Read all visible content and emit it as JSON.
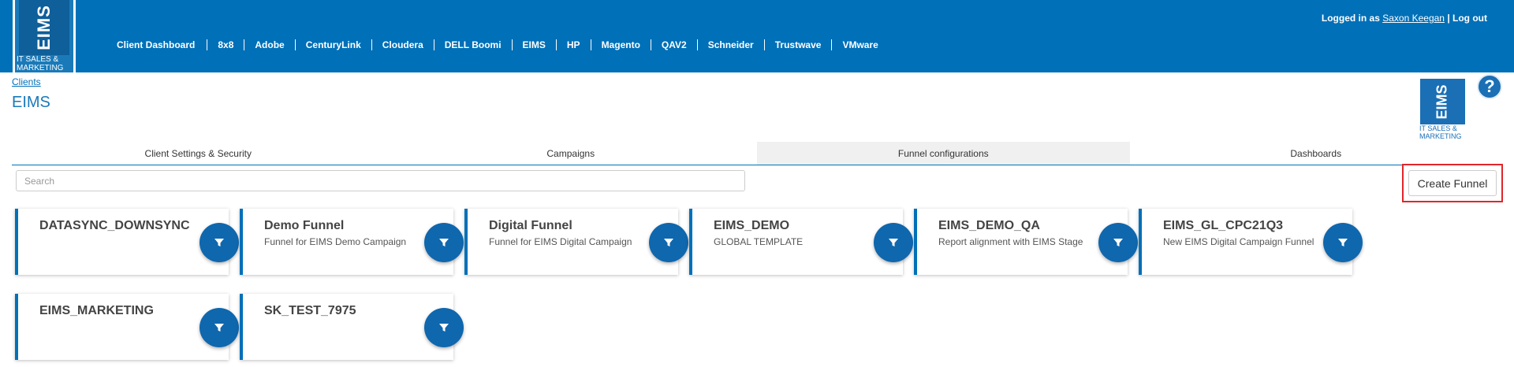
{
  "header": {
    "logo_word": "EIMS",
    "logo_tagline": "IT SALES & MARKETING",
    "nav": [
      "Client Dashboard",
      "8x8",
      "Adobe",
      "CenturyLink",
      "Cloudera",
      "DELL Boomi",
      "EIMS",
      "HP",
      "Magento",
      "QAV2",
      "Schneider",
      "Trustwave",
      "VMware"
    ],
    "login_prefix": "Logged in as",
    "user_name": "Saxon Keegan",
    "separator": "|",
    "logout": "Log out"
  },
  "breadcrumb": "Clients",
  "page_title": "EIMS",
  "help_label": "?",
  "tabs": [
    "Client Settings & Security",
    "Campaigns",
    "Funnel configurations",
    "Dashboards"
  ],
  "active_tab": "Funnel configurations",
  "search": {
    "placeholder": "Search",
    "value": ""
  },
  "create_funnel_label": "Create Funnel",
  "funnels": [
    {
      "title": "DATASYNC_DOWNSYNC",
      "desc": ""
    },
    {
      "title": "Demo Funnel",
      "desc": "Funnel for EIMS Demo Campaign"
    },
    {
      "title": "Digital Funnel",
      "desc": "Funnel for EIMS Digital Campaign"
    },
    {
      "title": "EIMS_DEMO",
      "desc": "GLOBAL TEMPLATE"
    },
    {
      "title": "EIMS_DEMO_QA",
      "desc": "Report alignment with EIMS Stage"
    },
    {
      "title": "EIMS_GL_CPC21Q3",
      "desc": "New EIMS Digital Campaign Funnel"
    },
    {
      "title": "EIMS_MARKETING",
      "desc": ""
    },
    {
      "title": "SK_TEST_7975",
      "desc": ""
    }
  ],
  "icons": {
    "funnel": "funnel-icon",
    "help": "question-icon"
  },
  "colors": {
    "brand": "#0070b8",
    "fab": "#0f67ae",
    "highlight": "#e0262b"
  }
}
